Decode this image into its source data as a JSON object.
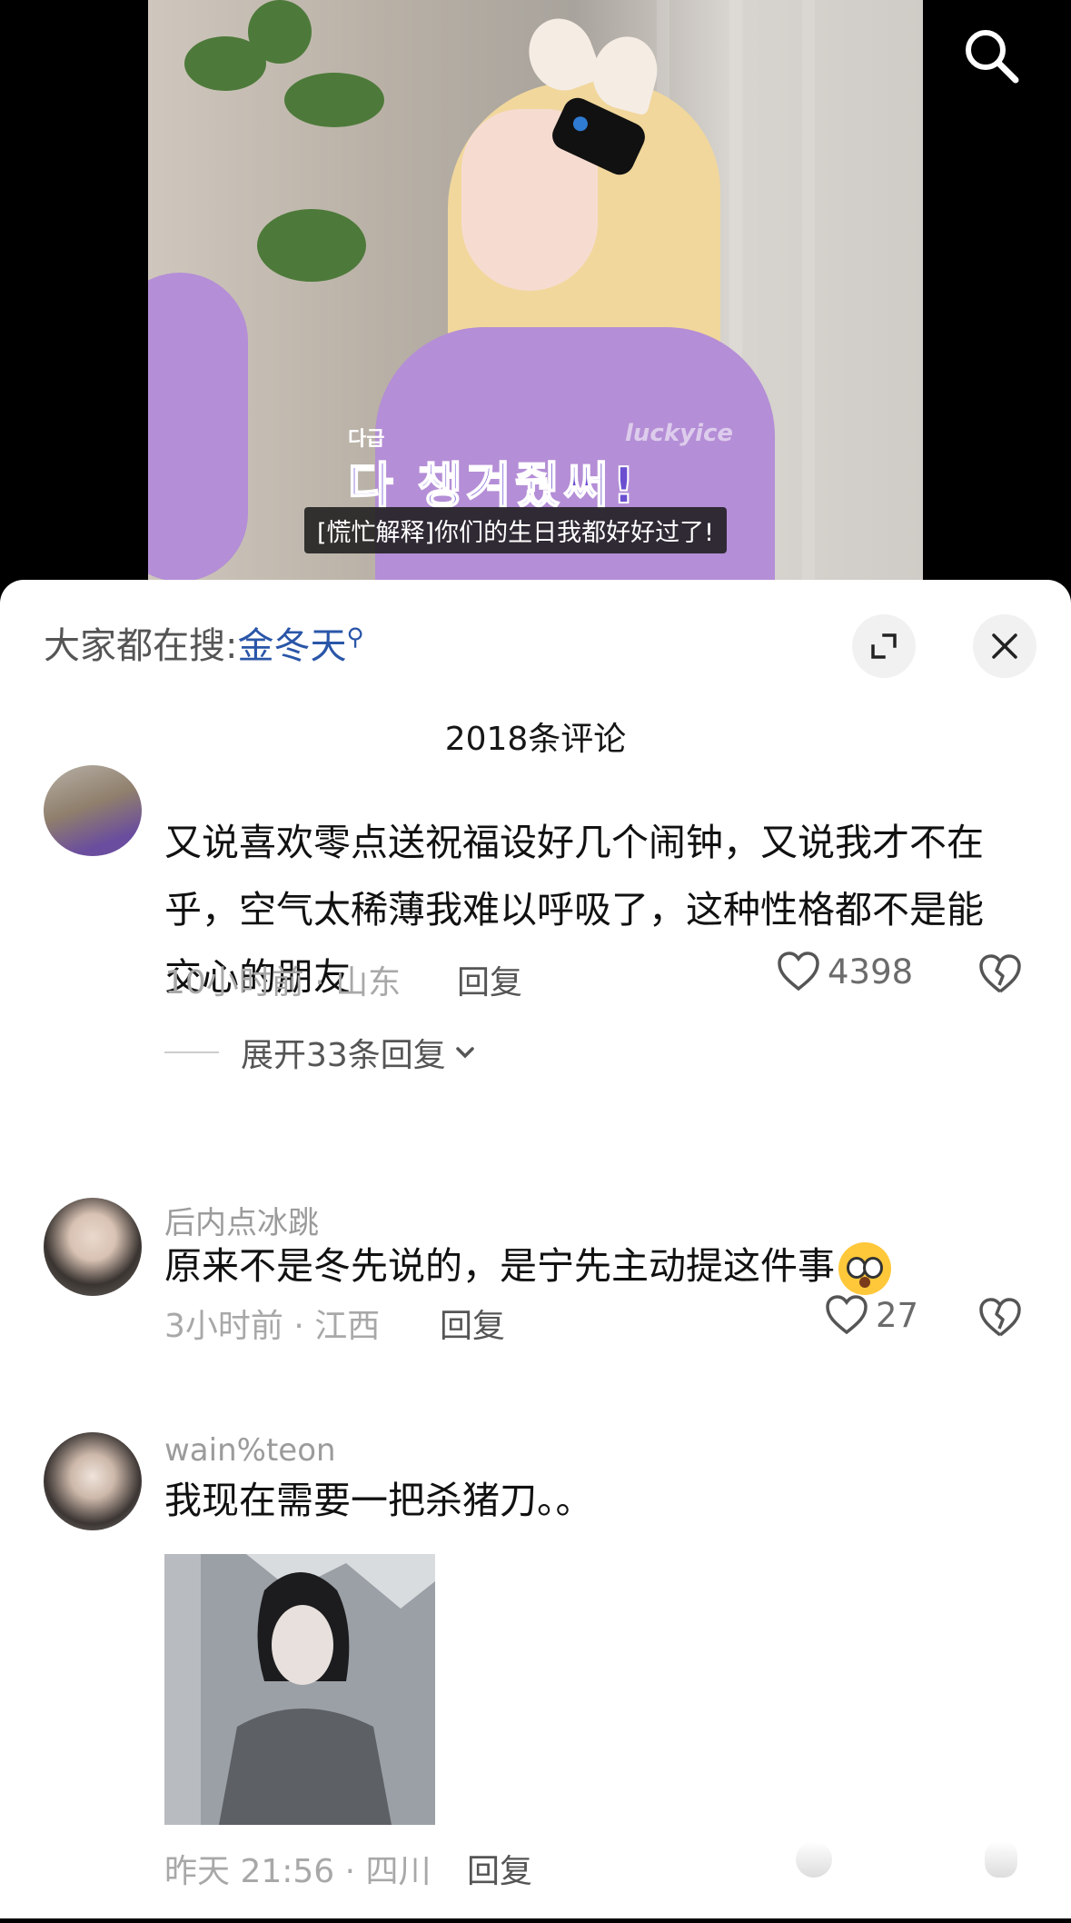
{
  "video": {
    "subtitle": "[慌忙解释]你们的生日我都好好过了!",
    "overlay_small": "다급",
    "overlay_big": "다 챙겨줬써!",
    "watermark": "luckyice"
  },
  "header": {
    "hot_search_prefix": "大家都在搜:",
    "hot_search_term": "金冬天",
    "comment_count_title": "2018条评论",
    "icons": [
      "search-icon",
      "minimize-icon",
      "close-icon"
    ]
  },
  "comments": [
    {
      "text": "又说喜欢零点送祝福设好几个闹钟，又说我才不在乎，空气太稀薄我难以呼吸了，这种性格都不是能交心的朋友",
      "time_location": "10小时前 · 山东",
      "reply_label": "回复",
      "likes": "4398",
      "expand_label": "展开33条回复"
    },
    {
      "username": "后内点冰跳",
      "text": "原来不是冬先说的，是宁先主动提这件事",
      "time_location": "3小时前 · 江西",
      "reply_label": "回复",
      "likes": "27"
    },
    {
      "username": "wain%teon",
      "text": "我现在需要一把杀猪刀。。",
      "time_location": "昨天 21:56 · 四川",
      "reply_label": "回复"
    }
  ],
  "colors": {
    "link": "#2a56a8",
    "meta": "#a8a8a8",
    "background": "#ffffff"
  }
}
